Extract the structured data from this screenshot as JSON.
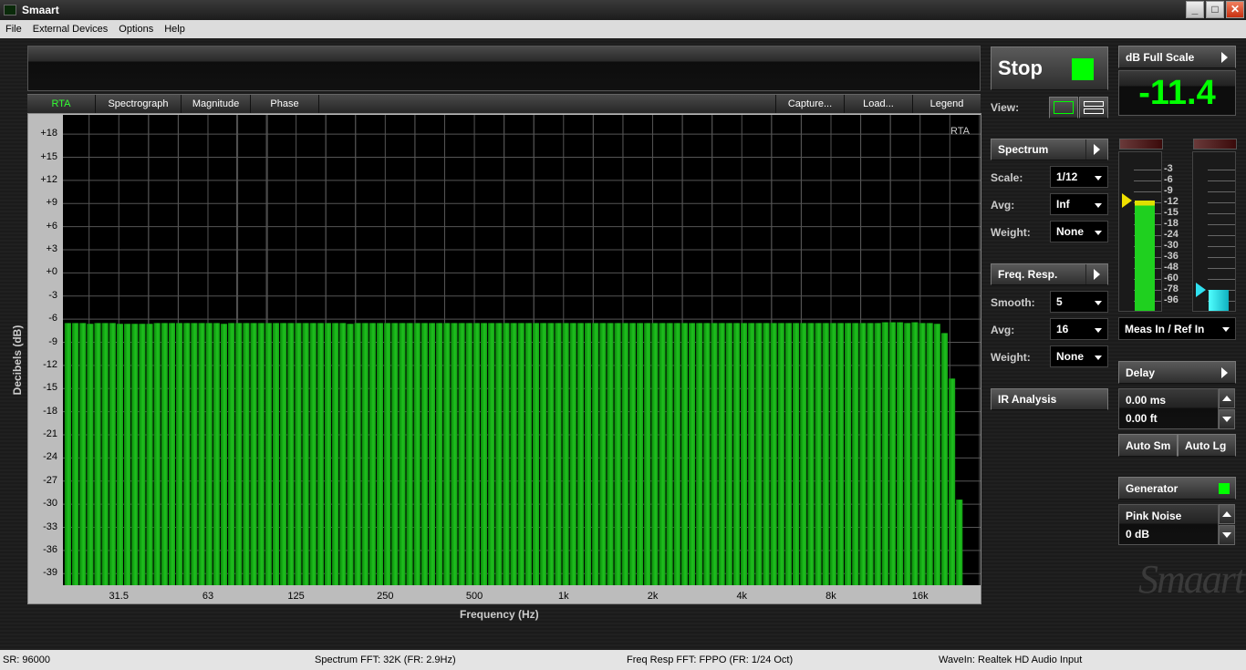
{
  "window": {
    "title": "Smaart",
    "minimize": "_",
    "maximize": "□",
    "close": "✕"
  },
  "menu": [
    "File",
    "External Devices",
    "Options",
    "Help"
  ],
  "tabs": {
    "left": [
      "RTA",
      "Spectrograph",
      "Magnitude",
      "Phase"
    ],
    "right": [
      "Capture...",
      "Load...",
      "Legend"
    ]
  },
  "chart_data": {
    "type": "bar",
    "title": "RTA",
    "xlabel": "Frequency (Hz)",
    "ylabel": "Decibels (dB)",
    "ylim": [
      -40.5,
      20.5
    ],
    "xlim_hz": [
      20.4,
      25600
    ],
    "yticks": [
      "+18",
      "+15",
      "+12",
      "+9",
      "+6",
      "+3",
      "+0",
      "-3",
      "-6",
      "-9",
      "-12",
      "-15",
      "-18",
      "-21",
      "-24",
      "-27",
      "-30",
      "-33",
      "-36",
      "-39"
    ],
    "ytick_values": [
      18,
      15,
      12,
      9,
      6,
      3,
      0,
      -3,
      -6,
      -9,
      -12,
      -15,
      -18,
      -21,
      -24,
      -27,
      -30,
      -33,
      -36,
      -39
    ],
    "xticks": [
      "31.5",
      "63",
      "125",
      "250",
      "500",
      "1k",
      "2k",
      "4k",
      "8k",
      "16k"
    ],
    "xtick_values": [
      31.5,
      63,
      125,
      250,
      500,
      1000,
      2000,
      4000,
      8000,
      16000
    ],
    "grid": true,
    "bands_per_octave": 12,
    "first_band_hz": 21.2,
    "values": [
      -6.5,
      -6.5,
      -6.5,
      -6.6,
      -6.5,
      -6.5,
      -6.5,
      -6.6,
      -6.6,
      -6.6,
      -6.6,
      -6.6,
      -6.5,
      -6.5,
      -6.5,
      -6.5,
      -6.5,
      -6.5,
      -6.5,
      -6.5,
      -6.5,
      -6.6,
      -6.5,
      -6.5,
      -6.5,
      -6.5,
      -6.5,
      -6.5,
      -6.5,
      -6.5,
      -6.5,
      -6.5,
      -6.5,
      -6.5,
      -6.5,
      -6.5,
      -6.5,
      -6.5,
      -6.6,
      -6.5,
      -6.5,
      -6.5,
      -6.5,
      -6.5,
      -6.5,
      -6.5,
      -6.5,
      -6.5,
      -6.5,
      -6.5,
      -6.5,
      -6.5,
      -6.5,
      -6.5,
      -6.5,
      -6.5,
      -6.5,
      -6.5,
      -6.5,
      -6.5,
      -6.5,
      -6.5,
      -6.5,
      -6.5,
      -6.5,
      -6.5,
      -6.5,
      -6.5,
      -6.5,
      -6.5,
      -6.5,
      -6.5,
      -6.5,
      -6.5,
      -6.5,
      -6.5,
      -6.5,
      -6.5,
      -6.5,
      -6.5,
      -6.5,
      -6.5,
      -6.5,
      -6.5,
      -6.5,
      -6.5,
      -6.5,
      -6.5,
      -6.5,
      -6.5,
      -6.5,
      -6.5,
      -6.5,
      -6.5,
      -6.5,
      -6.5,
      -6.5,
      -6.5,
      -6.5,
      -6.5,
      -6.5,
      -6.5,
      -6.5,
      -6.5,
      -6.5,
      -6.5,
      -6.5,
      -6.5,
      -6.5,
      -6.5,
      -6.4,
      -6.4,
      -6.4,
      -6.5,
      -6.4,
      -6.5,
      -6.5,
      -6.6,
      -7.8,
      -13.7,
      -29.4
    ],
    "bar_color": "#1fc01f"
  },
  "controls": {
    "stop_label": "Stop",
    "run_indicator_color": "#00ff00",
    "view_label": "View:",
    "spectrum": {
      "title": "Spectrum",
      "scale_label": "Scale:",
      "scale": "1/12",
      "avg_label": "Avg:",
      "avg": "Inf",
      "weight_label": "Weight:",
      "weight": "None"
    },
    "freq_resp": {
      "title": "Freq. Resp.",
      "smooth_label": "Smooth:",
      "smooth": "5",
      "avg_label": "Avg:",
      "avg": "16",
      "weight_label": "Weight:",
      "weight": "None"
    },
    "ir_analysis": "IR Analysis",
    "level": {
      "title": "dB Full Scale",
      "value": "-11.4"
    },
    "meter_scale": [
      "-3",
      "-6",
      "-9",
      "-12",
      "-15",
      "-18",
      "-24",
      "-30",
      "-36",
      "-48",
      "-60",
      "-78",
      "-96"
    ],
    "meter_left_level_db": -11.4,
    "meter_right_level_db": -78,
    "input_select": "Meas In / Ref In",
    "delay": {
      "title": "Delay",
      "ms": "0.00 ms",
      "ft": "0.00 ft",
      "auto_sm": "Auto Sm",
      "auto_lg": "Auto Lg"
    },
    "generator": {
      "title": "Generator",
      "signal": "Pink Noise",
      "level": "0 dB",
      "on_color": "#00ff00"
    },
    "watermark": "Smaart"
  },
  "status": {
    "sr": "SR: 96000",
    "spectrum_fft": "Spectrum FFT: 32K (FR: 2.9Hz)",
    "freq_resp_fft": "Freq Resp FFT: FPPO (FR: 1/24 Oct)",
    "wavein": "WaveIn: Realtek HD Audio Input"
  }
}
